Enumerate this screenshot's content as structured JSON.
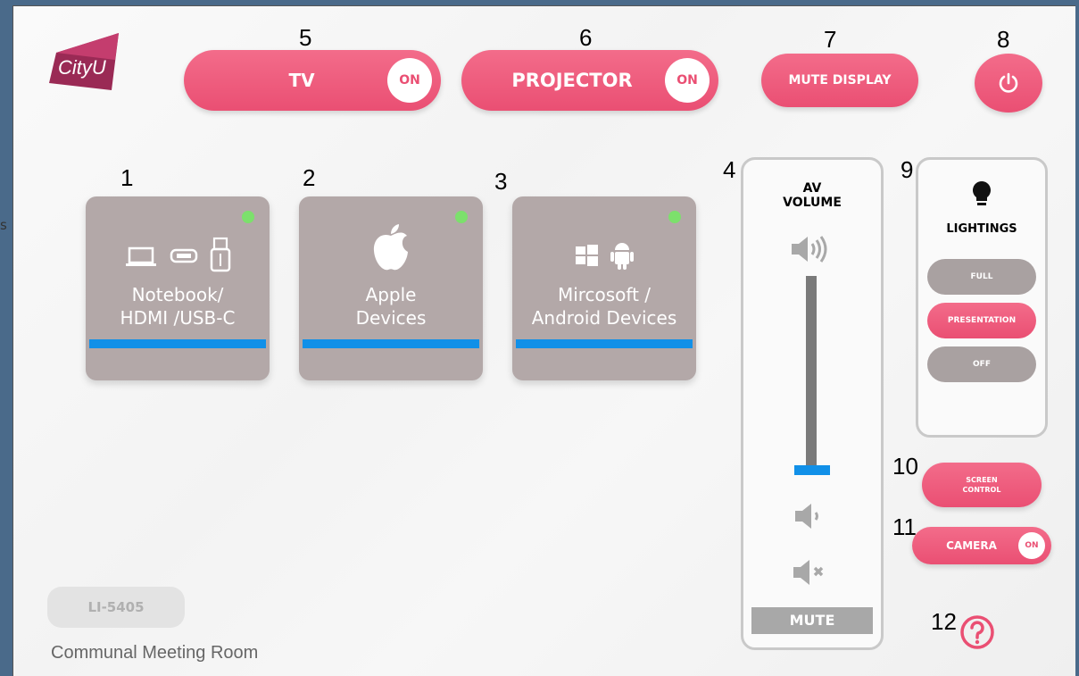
{
  "header": {
    "logo_text": "CityU",
    "tv": {
      "label": "TV",
      "state": "ON"
    },
    "projector": {
      "label": "PROJECTOR",
      "state": "ON"
    },
    "mute_display": "MUTE DISPLAY",
    "power_icon": "power-icon"
  },
  "callouts": [
    "1",
    "2",
    "3",
    "4",
    "5",
    "6",
    "7",
    "8",
    "9",
    "10",
    "11",
    "12"
  ],
  "stray_text": "s",
  "sources": [
    {
      "title_line1": "Notebook/",
      "title_line2": "HDMI /USB-C",
      "icons": [
        "laptop-icon",
        "hdmi-icon",
        "usb-icon"
      ],
      "active": true
    },
    {
      "title_line1": "Apple",
      "title_line2": "Devices",
      "icons": [
        "apple-icon"
      ],
      "active": true
    },
    {
      "title_line1": "Mircosoft /",
      "title_line2": "Android Devices",
      "icons": [
        "windows-icon",
        "android-icon"
      ],
      "active": true
    }
  ],
  "volume": {
    "title_line1": "AV",
    "title_line2": "VOLUME",
    "level": 0.05,
    "mute_label": "MUTE"
  },
  "lightings": {
    "title": "LIGHTINGS",
    "options": [
      "FULL",
      "PRESENTATION",
      "OFF"
    ],
    "selected": "PRESENTATION"
  },
  "screen_control": {
    "line1": "SCREEN",
    "line2": "CONTROL"
  },
  "camera": {
    "label": "CAMERA",
    "state": "ON"
  },
  "help_icon": "help-icon",
  "room": {
    "code": "LI-5405",
    "name": "Communal Meeting Room"
  },
  "colors": {
    "accent": "#ea4f73",
    "active_bar": "#1190e8",
    "tile": "#b3a8a8",
    "indicator": "#7ce06c"
  }
}
